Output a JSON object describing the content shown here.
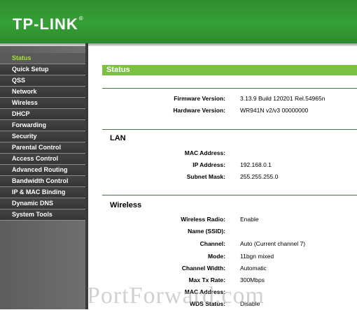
{
  "brand": {
    "name": "TP-LINK",
    "registered": "®"
  },
  "sidebar": {
    "items": [
      {
        "label": "Status",
        "active": true
      },
      {
        "label": "Quick Setup"
      },
      {
        "label": "QSS"
      },
      {
        "label": "Network"
      },
      {
        "label": "Wireless"
      },
      {
        "label": "DHCP"
      },
      {
        "label": "Forwarding"
      },
      {
        "label": "Security"
      },
      {
        "label": "Parental Control"
      },
      {
        "label": "Access Control"
      },
      {
        "label": "Advanced Routing"
      },
      {
        "label": "Bandwidth Control"
      },
      {
        "label": "IP & MAC Binding"
      },
      {
        "label": "Dynamic DNS"
      },
      {
        "label": "System Tools"
      }
    ]
  },
  "main": {
    "title": "Status",
    "firmware": {
      "label": "Firmware Version:",
      "value": "3.13.9 Build 120201 Rel.54965n"
    },
    "hardware": {
      "label": "Hardware Version:",
      "value": "WR941N v2/v3 00000000"
    },
    "lan": {
      "title": "LAN",
      "mac": {
        "label": "MAC Address:",
        "value": ""
      },
      "ip": {
        "label": "IP Address:",
        "value": "192.168.0.1"
      },
      "mask": {
        "label": "Subnet Mask:",
        "value": "255.255.255.0"
      }
    },
    "wireless": {
      "title": "Wireless",
      "radio": {
        "label": "Wireless Radio:",
        "value": "Enable"
      },
      "ssid": {
        "label": "Name (SSID):",
        "value": ""
      },
      "channel": {
        "label": "Channel:",
        "value": "Auto (Current channel 7)"
      },
      "mode": {
        "label": "Mode:",
        "value": "11bgn mixed"
      },
      "width": {
        "label": "Channel Width:",
        "value": "Automatic"
      },
      "rate": {
        "label": "Max Tx Rate:",
        "value": "300Mbps"
      },
      "mac": {
        "label": "MAC Address:",
        "value": ""
      },
      "wds": {
        "label": "WDS Status:",
        "value": "Disable"
      }
    }
  },
  "watermark": "PortForward.com",
  "colors": {
    "header": "#35a035",
    "accent": "#7bc143",
    "sidebar": "#3c3c3c"
  }
}
